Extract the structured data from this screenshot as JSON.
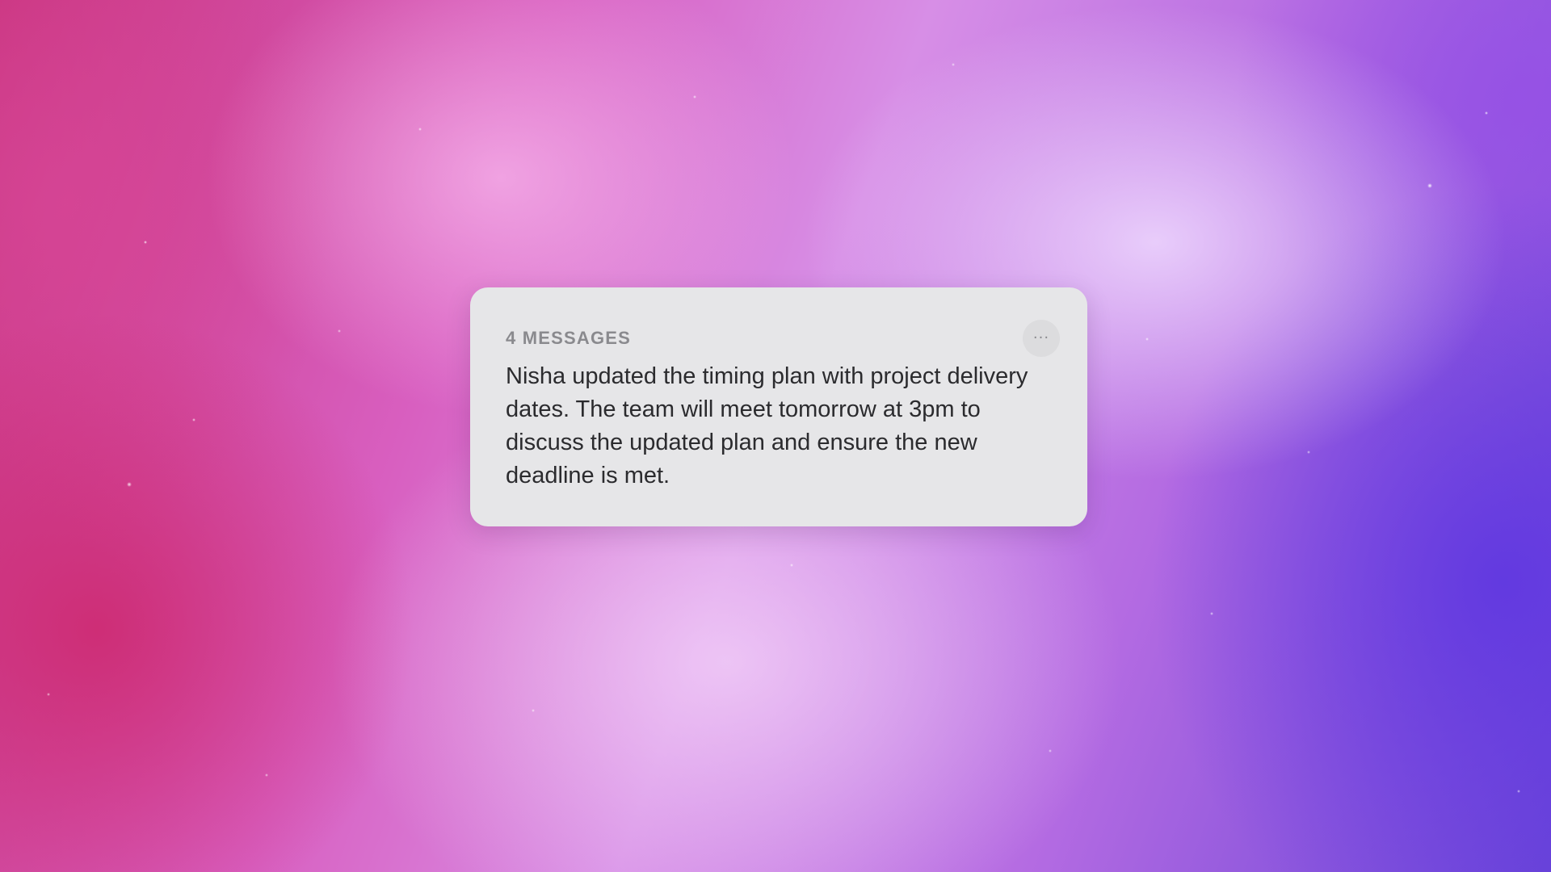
{
  "notification": {
    "count_label": "4 MESSAGES",
    "more_icon": "ellipsis-icon",
    "more_glyph": "···",
    "message": "Nisha updated the timing plan with project delivery dates. The team will meet tomorrow at 3pm to discuss the updated plan and ensure the new deadline is met."
  },
  "colors": {
    "card_background": "#e6e6e8",
    "label_gray": "#8a8a8e",
    "text_dark": "#2b2b2e"
  }
}
